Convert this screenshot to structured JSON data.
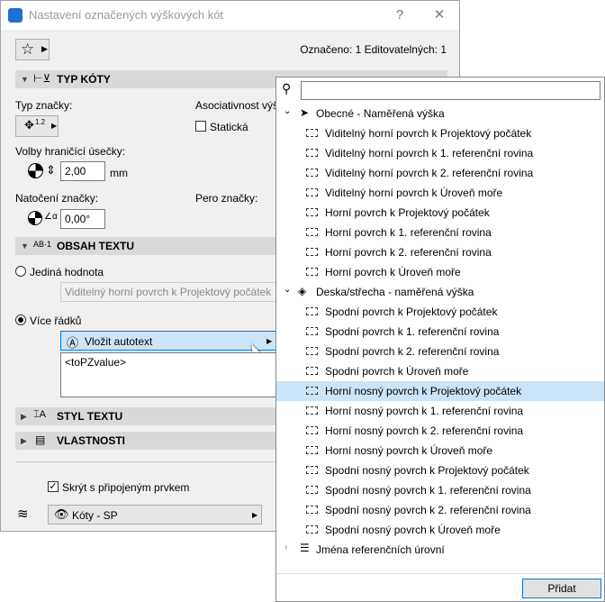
{
  "window": {
    "title": "Nastavení označených výškových kót",
    "help": "?",
    "close": "✕"
  },
  "header": {
    "selection_info": "Označeno: 1 Editovatelných: 1"
  },
  "sections": {
    "typ_koty": "TYP KÓTY",
    "obsah_textu": "OBSAH TEXTU",
    "styl_textu": "STYL TEXTU",
    "vlastnosti": "VLASTNOSTI"
  },
  "typ": {
    "typ_znacky": "Typ značky:",
    "asociativnost": "Asociativnost výšk",
    "staticka": "Statická",
    "volby": "Volby hraničící úsečky:",
    "size_value": "2,00",
    "unit": "mm",
    "natoceni": "Natočení značky:",
    "pero": "Pero značky:",
    "angle_value": "0,00°",
    "marker_size": "1.2"
  },
  "obsah": {
    "jedina": "Jediná hodnota",
    "jedina_placeholder": "Viditelný horní povrch k Projektový počátek",
    "vice": "Více řádků",
    "vlozit": "Vložit autotext",
    "text_value": "<toPZvalue>"
  },
  "bottom": {
    "skryt": "Skrýt s připojeným prvkem",
    "layer": "Kóty - SP"
  },
  "popup": {
    "search_placeholder": "",
    "group1": "Obecné - Naměřená výška",
    "group1_items": [
      "Viditelný horní povrch k Projektový počátek",
      "Viditelný horní povrch k 1. referenční rovina",
      "Viditelný horní povrch k 2. referenční rovina",
      "Viditelný horní povrch k Úroveň moře",
      "Horní povrch k Projektový počátek",
      "Horní povrch k 1. referenční rovina",
      "Horní povrch k 2. referenční rovina",
      "Horní povrch k Úroveň moře"
    ],
    "group2": "Deska/střecha - naměřená výška",
    "group2_items": [
      "Spodní povrch k Projektový počátek",
      "Spodní povrch k 1. referenční rovina",
      "Spodní povrch k 2. referenční rovina",
      "Spodní povrch k Úroveň moře",
      "Horní nosný povrch k Projektový počátek",
      "Horní nosný povrch k 1. referenční rovina",
      "Horní nosný povrch k 2. referenční rovina",
      "Horní nosný povrch k Úroveň moře",
      "Spodní nosný povrch k Projektový počátek",
      "Spodní nosný povrch k 1. referenční rovina",
      "Spodní nosný povrch k 2. referenční rovina",
      "Spodní nosný povrch k Úroveň moře"
    ],
    "group3": "Jména referenčních úrovní",
    "add": "Přidat"
  },
  "colors": {
    "highlight": "#cce4f7",
    "accent": "#0078d7",
    "section_bg": "#d9d9d9"
  }
}
